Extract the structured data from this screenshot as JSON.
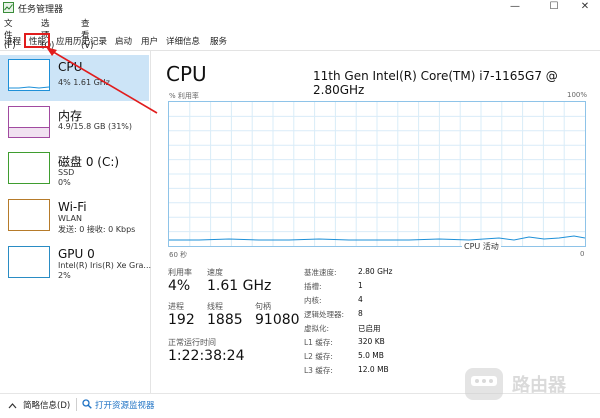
{
  "window": {
    "title": "任务管理器"
  },
  "window_controls": {
    "minimize": "—",
    "maximize": "☐",
    "close": "✕"
  },
  "menu": {
    "file": "文件(F)",
    "options": "选项(O)",
    "view": "查看(V)"
  },
  "tabs": [
    {
      "label": "进程"
    },
    {
      "label": "性能"
    },
    {
      "label": "应用历史记录"
    },
    {
      "label": "启动"
    },
    {
      "label": "用户"
    },
    {
      "label": "详细信息"
    },
    {
      "label": "服务"
    }
  ],
  "sidebar": {
    "items": [
      {
        "name": "CPU",
        "sub1": "4% 1.61 GHz",
        "color": "#1e90d8",
        "icon": "cpu-graph-icon"
      },
      {
        "name": "内存",
        "sub1": "4.9/15.8 GB (31%)",
        "color": "#a14aa0",
        "icon": "memory-graph-icon"
      },
      {
        "name": "磁盘 0 (C:)",
        "sub1": "SSD",
        "sub2": "0%",
        "color": "#3f9d2f",
        "icon": "disk-graph-icon"
      },
      {
        "name": "Wi-Fi",
        "sub1": "WLAN",
        "sub2": "发送: 0 接收: 0 Kbps",
        "color": "#b67b2a",
        "icon": "wifi-graph-icon"
      },
      {
        "name": "GPU 0",
        "sub1": "Intel(R) Iris(R) Xe Gra...",
        "sub2": "2%",
        "color": "#2a8cc4",
        "icon": "gpu-graph-icon"
      }
    ]
  },
  "main": {
    "title": "CPU",
    "model": "11th Gen Intel(R) Core(TM) i7-1165G7 @ 2.80GHz",
    "graph": {
      "y_label": "% 利用率",
      "y_max": "100%",
      "x_left": "60 秒",
      "x_right": "0",
      "legend": "CPU 活动"
    },
    "stats": {
      "util_label": "利用率",
      "util_value": "4%",
      "speed_label": "速度",
      "speed_value": "1.61 GHz",
      "proc_label": "进程",
      "proc_value": "192",
      "thread_label": "线程",
      "thread_value": "1885",
      "handle_label": "句柄",
      "handle_value": "91080",
      "uptime_label": "正常运行时间",
      "uptime_value": "1:22:38:24"
    },
    "specs": [
      {
        "label": "基准速度:",
        "value": "2.80 GHz"
      },
      {
        "label": "插槽:",
        "value": "1"
      },
      {
        "label": "内核:",
        "value": "4"
      },
      {
        "label": "逻辑处理器:",
        "value": "8"
      },
      {
        "label": "虚拟化:",
        "value": "已启用"
      },
      {
        "label": "L1 缓存:",
        "value": "320 KB"
      },
      {
        "label": "L2 缓存:",
        "value": "5.0 MB"
      },
      {
        "label": "L3 缓存:",
        "value": "12.0 MB"
      }
    ]
  },
  "footer": {
    "brief": "简略信息(D)",
    "monitor": "打开资源监视器"
  },
  "watermark": {
    "text": "路由器"
  },
  "colors": {
    "accent": "#1e90d8",
    "highlight": "#e11d1d",
    "selected_bg": "#cce4f7"
  }
}
